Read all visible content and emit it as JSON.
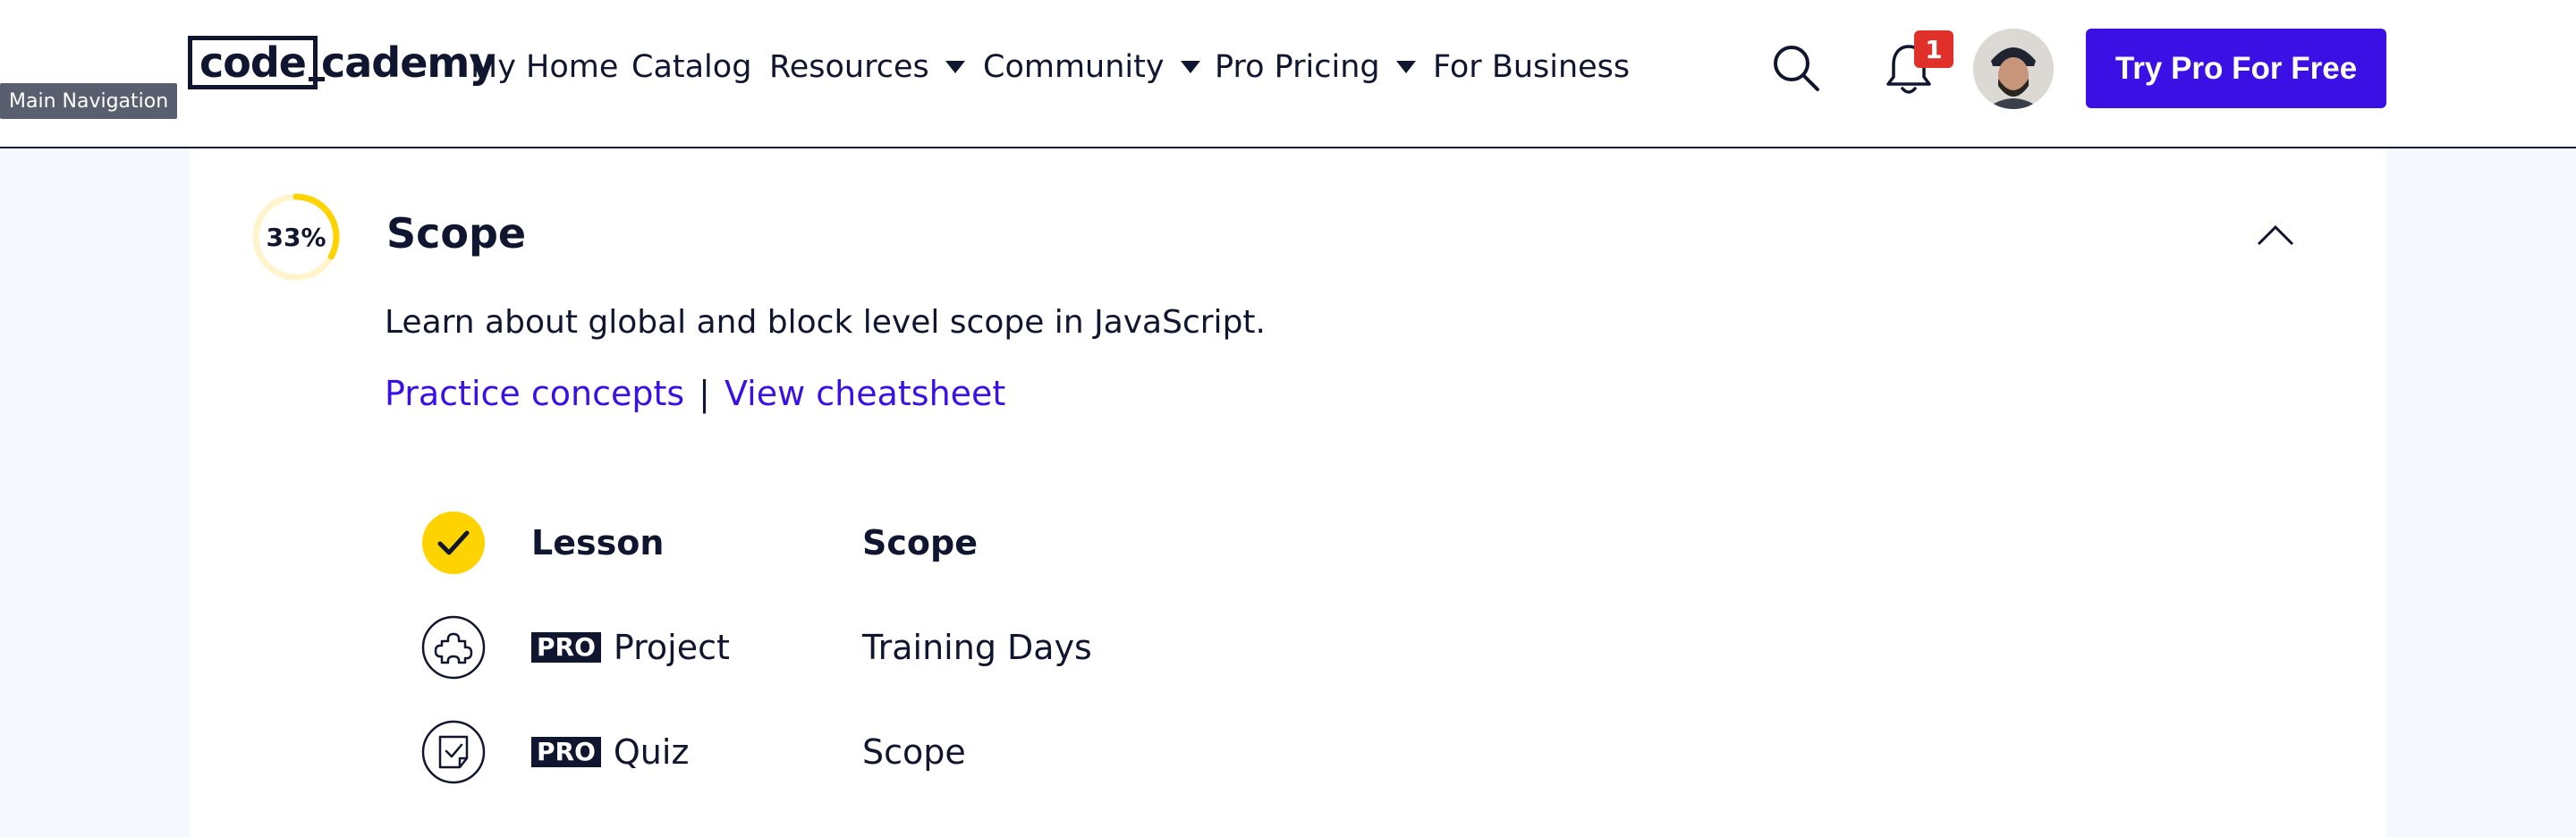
{
  "tooltip": "Main Navigation",
  "header": {
    "logo_part1": "code",
    "logo_part2": "cademy",
    "nav": [
      {
        "label": "My Home"
      },
      {
        "label": "Catalog"
      },
      {
        "label": "Resources"
      },
      {
        "label": "Community"
      },
      {
        "label": "Pro Pricing"
      },
      {
        "label": "For Business"
      }
    ],
    "notification_count": "1",
    "cta_label": "Try Pro For Free"
  },
  "section": {
    "progress": "33%",
    "progress_fraction": 0.33,
    "title": "Scope",
    "description": "Learn about global and block level scope in JavaScript.",
    "practice_link": "Practice concepts",
    "separator": "|",
    "cheatsheet_link": "View cheatsheet",
    "items": [
      {
        "type": "Lesson",
        "pro": "",
        "title": "Scope",
        "icon": "check-icon",
        "status": "complete"
      },
      {
        "type": "Project",
        "pro": "PRO",
        "title": "Training Days",
        "icon": "puzzle-icon"
      },
      {
        "type": "Quiz",
        "pro": "PRO",
        "title": "Scope",
        "icon": "quiz-icon"
      }
    ]
  },
  "colors": {
    "brand": "#3a10e5",
    "ink": "#10162f",
    "progress": "#ffd300",
    "badge": "#e0302a",
    "page_bg": "#f5f8ff"
  }
}
